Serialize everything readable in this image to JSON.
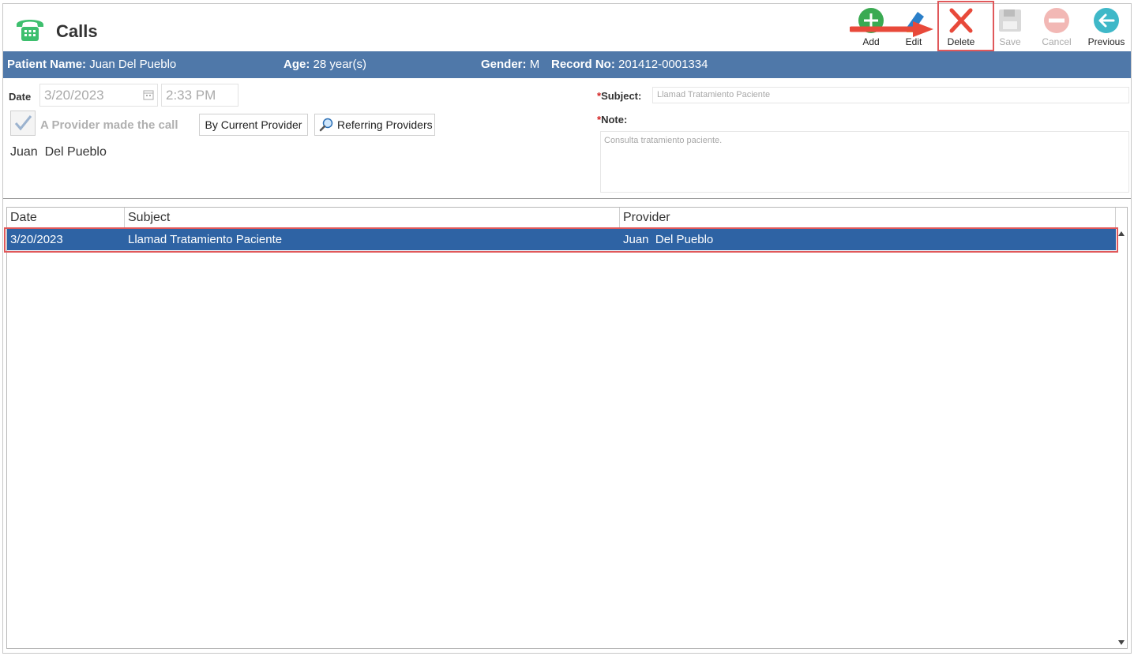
{
  "app": {
    "title": "Calls",
    "icon": "phone-icon"
  },
  "toolbar": {
    "add_label": "Add",
    "edit_label": "Edit",
    "delete_label": "Delete",
    "save_label": "Save",
    "cancel_label": "Cancel",
    "previous_label": "Previous"
  },
  "patient": {
    "name_label": "Patient Name:",
    "name_value": "Juan Del Pueblo",
    "age_label": "Age:",
    "age_value": "28 year(s)",
    "gender_label": "Gender:",
    "gender_value": "M",
    "record_label": "Record No:",
    "record_value": "201412-0001334"
  },
  "form": {
    "date_label": "Date",
    "date_value": "3/20/2023",
    "time_value": "2:33 PM",
    "provider_check_label": "A Provider made the call",
    "provider_checked": true,
    "by_current_provider_label": "By Current Provider",
    "referring_providers_label": "Referring Providers",
    "provider_name": "Juan  Del Pueblo",
    "subject_label": "Subject:",
    "subject_value": "Llamad Tratamiento Paciente",
    "note_label": "Note:",
    "note_value": "Consulta tratamiento paciente.",
    "required_mark": "*"
  },
  "grid": {
    "columns": [
      "Date",
      "Subject",
      "Provider"
    ],
    "rows": [
      {
        "date": "3/20/2023",
        "subject": "Llamad Tratamiento Paciente",
        "provider": "Juan  Del Pueblo",
        "selected": true
      }
    ]
  },
  "colors": {
    "patient_bar": "#4f78a9",
    "selected_row": "#2e63a4",
    "highlight": "#e0585a",
    "add_green": "#3aaa52",
    "previous_teal": "#3fb8c8"
  }
}
